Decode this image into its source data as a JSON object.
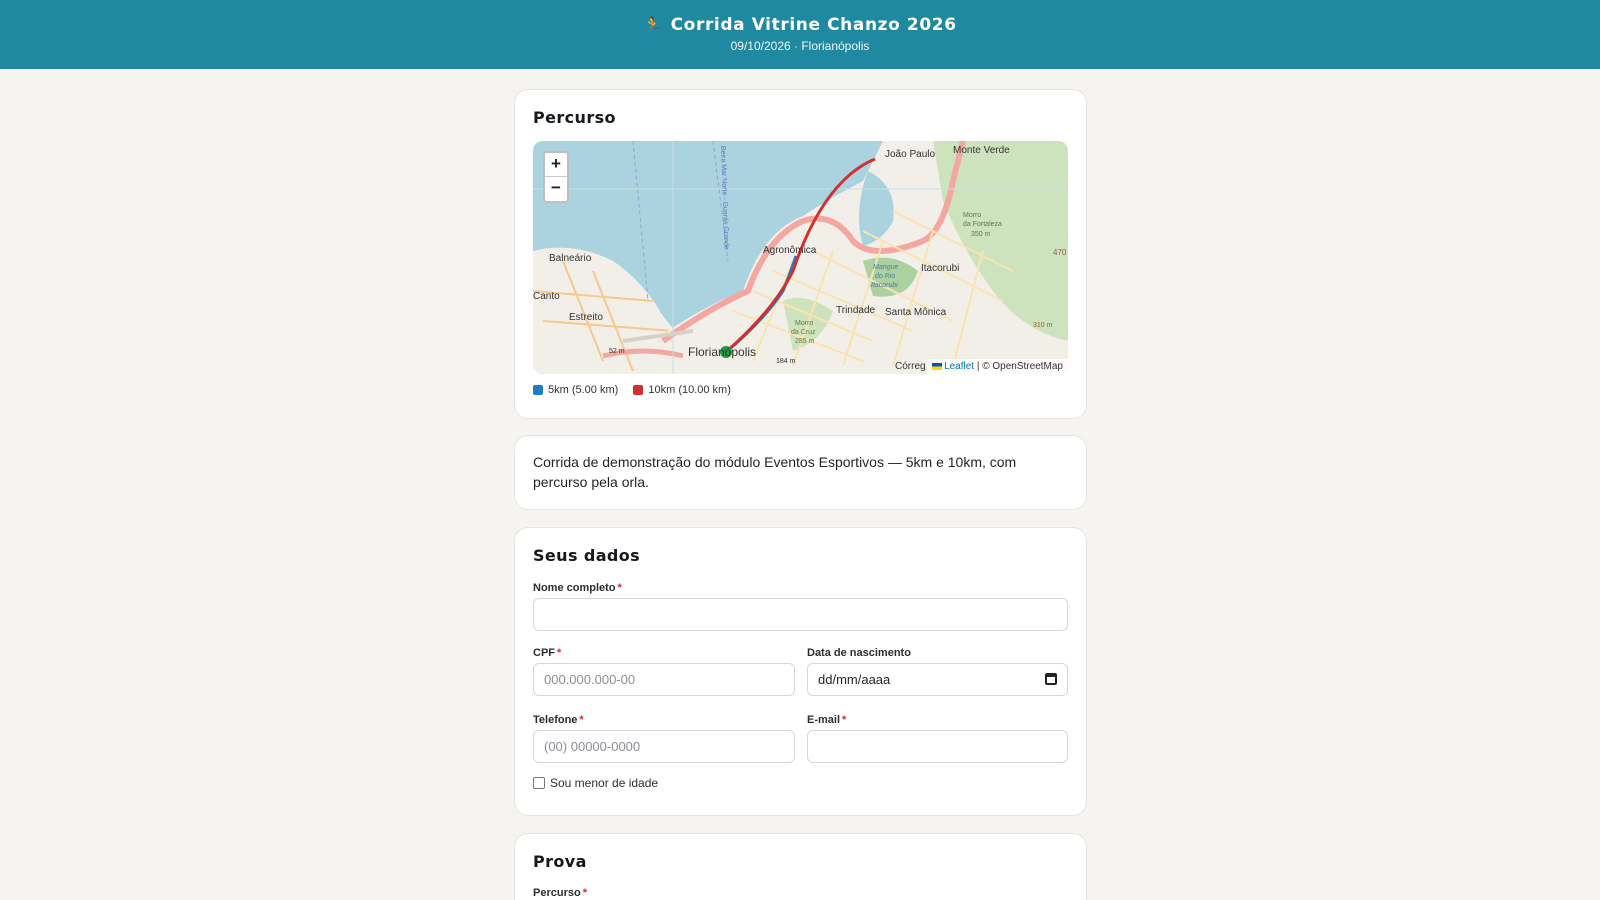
{
  "header": {
    "runner_icon": "runner-icon",
    "title": "Corrida Vitrine Chanzo 2026",
    "subtitle": "09/10/2026 · Florianópolis"
  },
  "route_card": {
    "title": "Percurso",
    "map": {
      "zoom_in": "+",
      "zoom_out": "−",
      "attribution_leaflet": "Leaflet",
      "attribution_osm": "| © OpenStreetMap",
      "place_labels": [
        "João Paulo",
        "Monte Verde",
        "Morro da Fortaleza",
        "350 m",
        "470",
        "Agronômica",
        "Balneário",
        "Itacorubi",
        "Mangue do Rio Itacorubi",
        "Canto",
        "Estreito",
        "Trindade",
        "Santa Mônica",
        "Morro da Cruz",
        "285 m",
        "310 m",
        "Florianópolis",
        "52 m",
        "184 m",
        "Córreg",
        "Beira Mar Norte - Guarás Grande"
      ],
      "route_colors": {
        "5km": "#1f7ec1",
        "10km": "#d32f2f",
        "start": "#1a9e3f"
      }
    },
    "legend": [
      {
        "label": "5km (5.00 km)",
        "color": "#1f7ec1"
      },
      {
        "label": "10km (10.00 km)",
        "color": "#d32f2f"
      }
    ]
  },
  "description": "Corrida de demonstração do módulo Eventos Esportivos — 5km e 10km, com percurso pela orla.",
  "personal": {
    "title": "Seus dados",
    "name_label": "Nome completo",
    "name_value": "",
    "cpf_label": "CPF",
    "cpf_placeholder": "000.000.000-00",
    "birth_label": "Data de nascimento",
    "birth_value": "dd/mm/aaaa",
    "phone_label": "Telefone",
    "phone_placeholder": "(00) 00000-0000",
    "email_label": "E-mail",
    "email_value": "",
    "minor_label": "Sou menor de idade",
    "required_mark": "*"
  },
  "race": {
    "title": "Prova",
    "route_label": "Percurso"
  }
}
